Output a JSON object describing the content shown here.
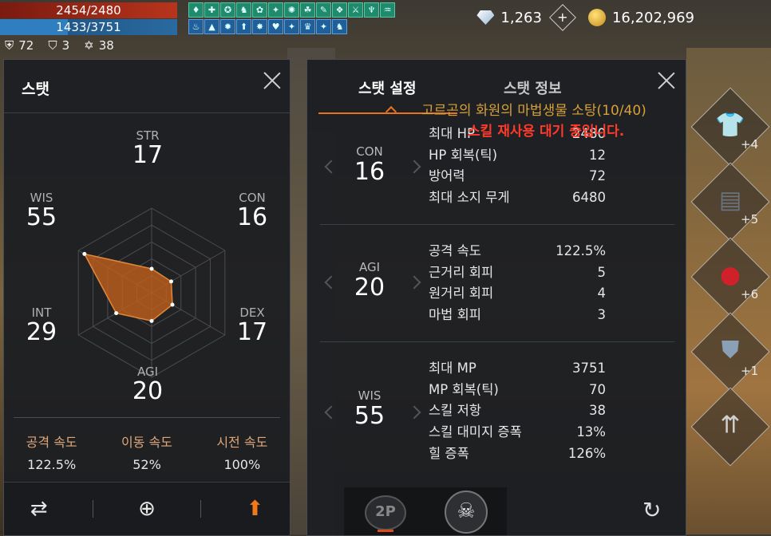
{
  "hud": {
    "hp": "2454/2480",
    "hp_fraction": 0.99,
    "mp": "1433/3751",
    "mp_fraction": 0.38,
    "defense": "72",
    "guard": "3",
    "level_points": "38",
    "buff_row1": [
      "♦",
      "✚",
      "✪",
      "♞",
      "✿",
      "✦",
      "✺",
      "☘",
      "✎",
      "❖",
      "⚔",
      "♆",
      "♒"
    ],
    "buff_row2": [
      "♨",
      "▲",
      "✹",
      "⬆",
      "✸",
      "♥",
      "✦",
      "♛",
      "✦",
      "♞"
    ]
  },
  "currency": {
    "diamonds": "1,263",
    "gold": "16,202,969"
  },
  "left_panel": {
    "title": "스탯",
    "stats": {
      "str": {
        "key": "STR",
        "value": "17"
      },
      "con": {
        "key": "CON",
        "value": "16"
      },
      "dex": {
        "key": "DEX",
        "value": "17"
      },
      "agi": {
        "key": "AGI",
        "value": "20"
      },
      "int": {
        "key": "INT",
        "value": "29"
      },
      "wis": {
        "key": "WIS",
        "value": "55"
      }
    },
    "speeds": [
      {
        "label": "공격 속도",
        "value": "122.5%"
      },
      {
        "label": "이동 속도",
        "value": "52%"
      },
      {
        "label": "시전 속도",
        "value": "100%"
      }
    ]
  },
  "right_panel": {
    "tabs": [
      "스탯 설정",
      "스탯 정보"
    ],
    "sections": [
      {
        "stat": "CON",
        "value": "16",
        "rows": [
          {
            "label": "최대 HP",
            "value": "2480"
          },
          {
            "label": "HP 회복(틱)",
            "value": "12"
          },
          {
            "label": "방어력",
            "value": "72"
          },
          {
            "label": "최대 소지 무게",
            "value": "6480"
          }
        ]
      },
      {
        "stat": "AGI",
        "value": "20",
        "rows": [
          {
            "label": "공격 속도",
            "value": "122.5%"
          },
          {
            "label": "근거리 회피",
            "value": "5"
          },
          {
            "label": "원거리 회피",
            "value": "4"
          },
          {
            "label": "마법 회피",
            "value": "3"
          }
        ]
      },
      {
        "stat": "WIS",
        "value": "55",
        "rows": [
          {
            "label": "최대 MP",
            "value": "3751"
          },
          {
            "label": "MP 회복(틱)",
            "value": "70"
          },
          {
            "label": "스킬 저항",
            "value": "38"
          },
          {
            "label": "스킬 대미지 증폭",
            "value": "13%"
          },
          {
            "label": "힐 증폭",
            "value": "126%"
          }
        ]
      }
    ],
    "footer": {
      "party_label": "2P"
    }
  },
  "overlay": {
    "quest": "고르곤의 화원의 마법생물 소탕(10/40)",
    "warning": "스킬 재사용 대기 중입니다."
  },
  "equipment": [
    {
      "name": "armor-shirt",
      "enhance": "+4"
    },
    {
      "name": "armor-plate",
      "enhance": "+5"
    },
    {
      "name": "gauntlet",
      "enhance": "+6"
    },
    {
      "name": "shield",
      "enhance": "+1"
    },
    {
      "name": "arrows",
      "enhance": ""
    }
  ],
  "colors": {
    "accent": "#e8721f",
    "radar_fill": "#c0601a",
    "warning": "#ff3a2a",
    "quest": "#d6a037"
  }
}
